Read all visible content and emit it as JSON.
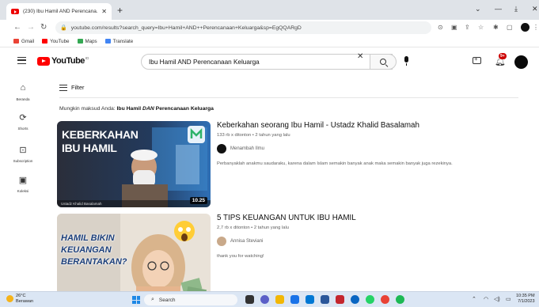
{
  "browser": {
    "tab_title": "(230) Ibu Hamil AND Perencana...",
    "url": "youtube.com/results?search_query=Ibu+Hamil+AND++Perencanaan+Keluarga&sp=EgQQARgD",
    "bookmarks": [
      {
        "label": "Gmail",
        "color": "#ea4335"
      },
      {
        "label": "YouTube",
        "color": "#ff0000"
      },
      {
        "label": "Maps",
        "color": "#34a853"
      },
      {
        "label": "Translate",
        "color": "#4285f4"
      }
    ]
  },
  "youtube": {
    "logo_text": "YouTube",
    "logo_country": "ID",
    "search_value": "Ibu Hamil AND  Perencanaan Keluarga",
    "notification_count": "9+",
    "filter_label": "Filter",
    "did_you_mean": {
      "prefix": "Mungkin maksud Anda:",
      "bold_1": "Ibu Hamil",
      "italic": "DAN",
      "bold_2": "Perencanaan Keluarga"
    }
  },
  "guide": [
    {
      "label": "Beranda",
      "icon": "home-icon"
    },
    {
      "label": "Shorts",
      "icon": "shorts-icon"
    },
    {
      "label": "Subscription",
      "icon": "subscriptions-icon"
    },
    {
      "label": "Koleksi",
      "icon": "library-icon"
    }
  ],
  "results": [
    {
      "title": "Keberkahan seorang Ibu Hamil - Ustadz Khalid Basalamah",
      "stats": "133 rb x ditonton • 2 tahun yang lalu",
      "channel": "Menambah Ilmu",
      "description": "Perbanyaklah anakmu saudaraku, karena dalam Islam semakin banyak anak maka semakin banyak juga rezekinya.",
      "duration": "10.25",
      "thumb_text_1": "KEBERKAHAN",
      "thumb_text_2": "IBU HAMIL",
      "thumb_caption": "Ustadz Khalid Basalamah"
    },
    {
      "title": "5 TIPS KEUANGAN UNTUK IBU HAMIL",
      "stats": "2,7 rb x ditonton • 2 tahun yang lalu",
      "channel": "Annisa Steviani",
      "description": "thank you for watching!",
      "thumb_text_1": "HAMIL BIKIN",
      "thumb_text_2": "KEUANGAN",
      "thumb_text_3": "BERANTAKAN?"
    }
  ],
  "taskbar": {
    "temperature": "26°C",
    "weather": "Berawan",
    "search_label": "Search",
    "time": "10:35 PM",
    "date": "7/1/2023"
  }
}
